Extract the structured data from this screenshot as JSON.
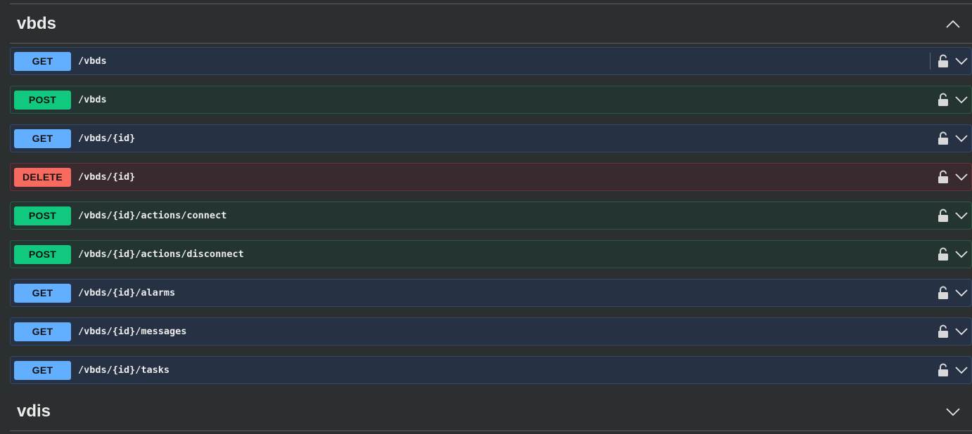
{
  "sections": [
    {
      "name": "vbds",
      "expanded": true
    },
    {
      "name": "vdis",
      "expanded": false
    }
  ],
  "operations": [
    {
      "method": "GET",
      "path": "/vbds"
    },
    {
      "method": "POST",
      "path": "/vbds"
    },
    {
      "method": "GET",
      "path": "/vbds/{id}"
    },
    {
      "method": "DELETE",
      "path": "/vbds/{id}"
    },
    {
      "method": "POST",
      "path": "/vbds/{id}/actions/connect"
    },
    {
      "method": "POST",
      "path": "/vbds/{id}/actions/disconnect"
    },
    {
      "method": "GET",
      "path": "/vbds/{id}/alarms"
    },
    {
      "method": "GET",
      "path": "/vbds/{id}/messages"
    },
    {
      "method": "GET",
      "path": "/vbds/{id}/tasks"
    }
  ],
  "icons": {
    "lock": "lock-open-icon",
    "expand": "chevron-down-icon",
    "collapse": "chevron-up-icon"
  },
  "colors": {
    "get": "#61affe",
    "post": "#10c97f",
    "delete": "#f96a5e"
  }
}
